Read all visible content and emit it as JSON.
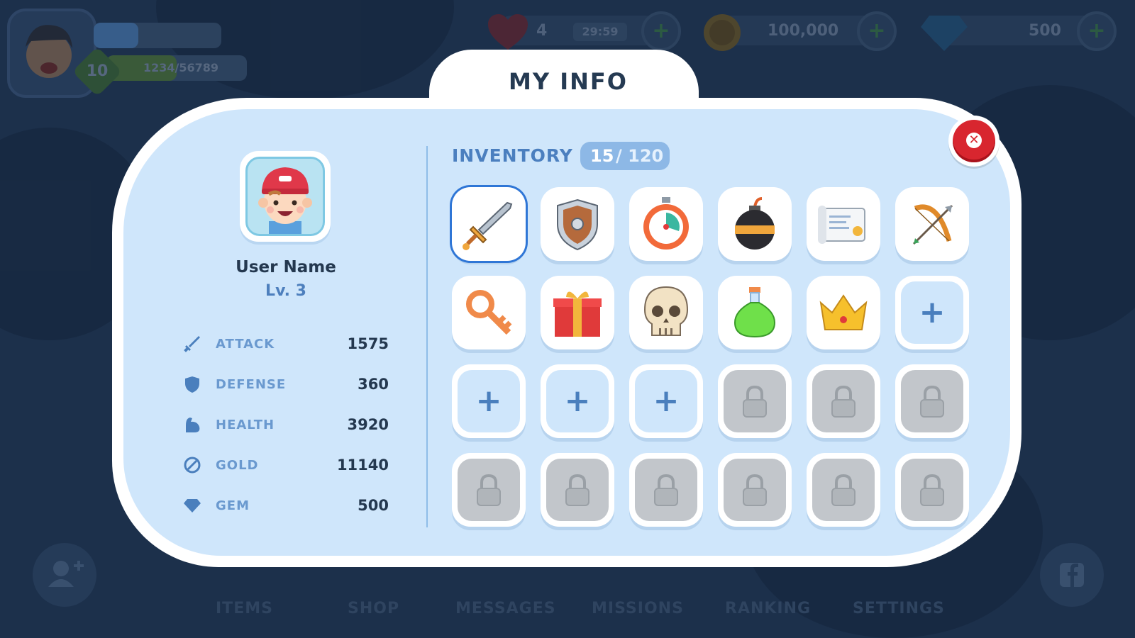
{
  "hud": {
    "level": "10",
    "xp_text": "1234/56789",
    "xp_fraction": 0.35,
    "level_fraction": 0.5,
    "lives": "4",
    "timer": "29:59",
    "coins": "100,000",
    "gems": "500"
  },
  "nav": {
    "items": [
      "ITEMS",
      "SHOP",
      "MESSAGES",
      "MISSIONS",
      "RANKING",
      "SETTINGS"
    ]
  },
  "modal": {
    "title": "MY INFO",
    "profile": {
      "name": "User Name",
      "level": "Lv. 3"
    },
    "stats": [
      {
        "label": "ATTACK",
        "value": "1575",
        "icon": "sword-icon"
      },
      {
        "label": "DEFENSE",
        "value": "360",
        "icon": "shield-icon"
      },
      {
        "label": "HEALTH",
        "value": "3920",
        "icon": "muscle-icon"
      },
      {
        "label": "GOLD",
        "value": "11140",
        "icon": "coin-icon"
      },
      {
        "label": "GEM",
        "value": "500",
        "icon": "gem-icon"
      }
    ],
    "inventory": {
      "title": "INVENTORY",
      "used": "15",
      "capacity": "/ 120",
      "items": [
        "sword",
        "shield",
        "stopwatch",
        "bomb",
        "scroll",
        "bow",
        "key",
        "gift",
        "skull",
        "potion",
        "crown",
        "add",
        "add",
        "add",
        "add",
        "locked",
        "locked",
        "locked",
        "locked",
        "locked",
        "locked",
        "locked",
        "locked",
        "locked"
      ]
    }
  },
  "colors": {
    "panel": "#cfe6fb",
    "accent": "#4b7fbf",
    "close": "#d8262f"
  }
}
